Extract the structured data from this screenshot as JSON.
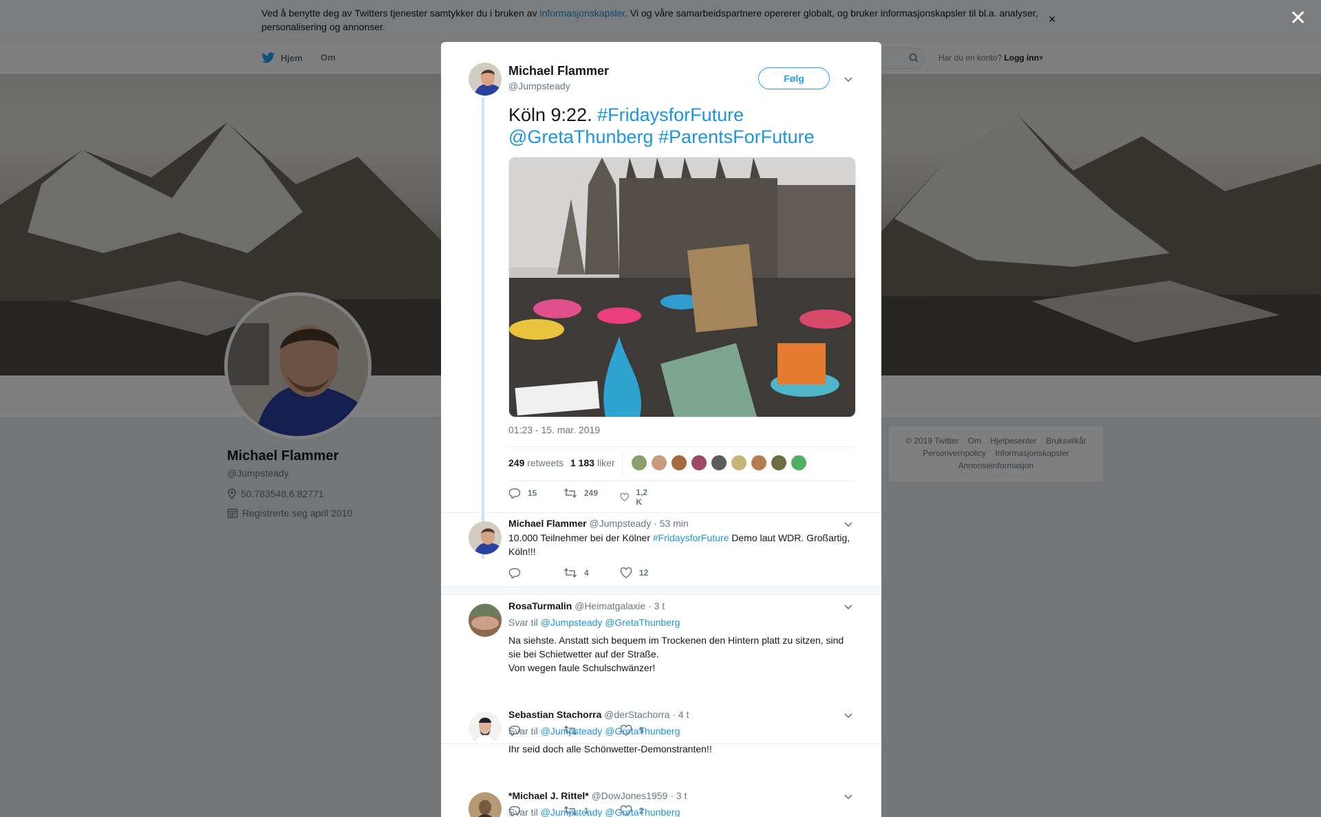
{
  "cookie": {
    "text_before": "Ved å benytte deg av Twitters tjenester samtykker du i bruken av ",
    "link": "informasjonskapsler",
    "text_after": ". Vi og våre samarbeidspartnere opererer globalt, og bruker informasjonskapsler til bl.a. analyser, personalisering og annonser.",
    "close": "×"
  },
  "nav": {
    "home": "Hjem",
    "about": "Om",
    "has_account": "Har du en konto?",
    "login": "Logg inn"
  },
  "profile": {
    "name": "Michael Flammer",
    "handle": "@Jumpsteady",
    "location": "50.783548,6.82771",
    "joined": "Registrerte seg april 2010"
  },
  "footer": {
    "items": [
      "© 2019 Twitter",
      "Om",
      "Hjelpesenter",
      "Bruksvilkår",
      "Personvernpolicy",
      "Informasjonskapsler",
      "Annonseinformasjon"
    ]
  },
  "modal": {
    "close": "✕",
    "tweet": {
      "name": "Michael Flammer",
      "handle": "@Jumpsteady",
      "follow": "Følg",
      "text_plain": "Köln 9:22. ",
      "tag1": "#FridaysforFuture",
      "mention": "@GretaThunberg",
      "tag2": "#ParentsForFuture",
      "time": "01:23 - 15. mar. 2019",
      "retweets_count": "249",
      "retweets_label": "retweets",
      "likes_count": "1 183",
      "likes_label": "liker",
      "reply_count": "15",
      "retweet_count": "249",
      "like_count": "1,2 K"
    },
    "replies": [
      {
        "name": "Michael Flammer",
        "handle": "@Jumpsteady",
        "time": "· 53 min",
        "reply_to": "",
        "mentions": "",
        "text_before": "10.000 Teilnehmer bei der Kölner ",
        "tag": "#FridaysforFuture",
        "text_after": " Demo laut WDR. Großartig, Köln!!!",
        "reply_count": "",
        "retweet_count": "4",
        "like_count": "12"
      },
      {
        "name": "RosaTurmalin",
        "handle": "@Heimatgalaxie",
        "time": "· 3 t",
        "reply_to": "Svar til",
        "mentions": "@Jumpsteady @GretaThunberg",
        "line1": "Na siehste. Anstatt sich bequem im Trockenen den Hintern platt zu sitzen, sind sie bei Schietwetter auf der Straße.",
        "line2": "Von wegen faule Schulschwänzer!",
        "reply_count": "",
        "retweet_count": "",
        "like_count": "5"
      },
      {
        "name": "Sebastian Stachorra",
        "handle": "@derStachorra",
        "time": "· 4 t",
        "reply_to": "Svar til",
        "mentions": "@Jumpsteady @GretaThunberg",
        "text": "Ihr seid doch alle Schönwetter-Demonstranten!!",
        "reply_count": "",
        "retweet_count": "1",
        "like_count": "2"
      },
      {
        "name": "*Michael J. Rittel*",
        "handle": "@DowJones1959",
        "time": "· 3 t",
        "reply_to": "Svar til",
        "mentions": "@Jumpsteady @GretaThunberg"
      }
    ]
  }
}
